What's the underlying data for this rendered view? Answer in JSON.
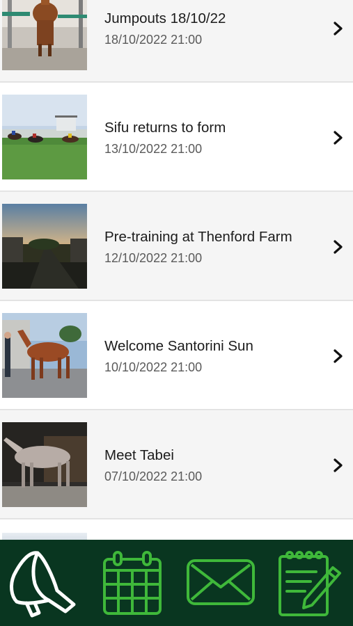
{
  "news": {
    "items": [
      {
        "title": "Jumpouts 18/10/22",
        "date": "18/10/2022 21:00",
        "image": "horse-in-stable-photo"
      },
      {
        "title": "Sifu returns to form",
        "date": "13/10/2022 21:00",
        "image": "horse-race-photo"
      },
      {
        "title": "Pre-training at Thenford Farm",
        "date": "12/10/2022 21:00",
        "image": "farm-sunset-photo"
      },
      {
        "title": "Welcome Santorini Sun",
        "date": "10/10/2022 21:00",
        "image": "chestnut-horse-photo"
      },
      {
        "title": "Meet Tabei",
        "date": "07/10/2022 21:00",
        "image": "grey-horse-photo"
      }
    ]
  },
  "tabbar": {
    "tabs": [
      {
        "icon": "megaphone-icon",
        "active": true
      },
      {
        "icon": "calendar-icon",
        "active": false
      },
      {
        "icon": "envelope-icon",
        "active": false
      },
      {
        "icon": "notepad-icon",
        "active": false
      }
    ]
  },
  "colors": {
    "tabbar_background": "#093620",
    "tab_icon": "#3fb83a",
    "tab_icon_active": "#ffffff",
    "row_alt": "#f5f5f5"
  }
}
